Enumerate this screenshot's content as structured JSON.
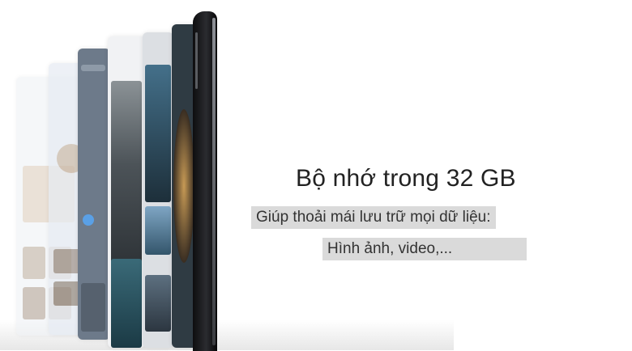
{
  "banner": {
    "title": "Bộ nhớ trong 32 GB",
    "line1": "Giúp thoải mái lưu trữ mọi dữ liệu:",
    "line2": "Hình ảnh, video,..."
  },
  "colors": {
    "text": "#222222",
    "highlight": "#dadada",
    "phone": "#111114"
  }
}
